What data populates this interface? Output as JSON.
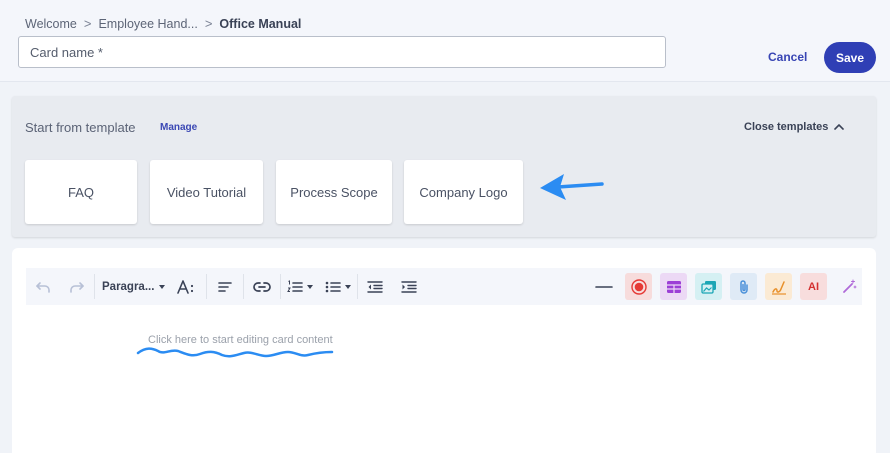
{
  "breadcrumb": {
    "items": [
      "Welcome",
      "Employee Hand..."
    ],
    "current": "Office Manual",
    "separator": ">"
  },
  "card_name": {
    "placeholder": "Card name *",
    "value": ""
  },
  "actions": {
    "cancel_label": "Cancel",
    "save_label": "Save"
  },
  "templates": {
    "label": "Start from template",
    "manage_label": "Manage",
    "close_label": "Close templates",
    "items": [
      "FAQ",
      "Video Tutorial",
      "Process Scope",
      "Company Logo"
    ]
  },
  "toolbar": {
    "paragraph_label": "Paragra...",
    "ai_label": "AI",
    "icons": [
      "undo-icon",
      "redo-icon",
      "text-style-icon",
      "align-icon",
      "link-icon",
      "ordered-list-icon",
      "bullet-list-icon",
      "outdent-icon",
      "indent-icon",
      "horizontal-rule-icon",
      "record-icon",
      "table-icon",
      "image-icon",
      "attachment-icon",
      "signature-icon",
      "ai-icon",
      "magic-wand-icon"
    ]
  },
  "editor": {
    "placeholder": "Click here to start editing card content"
  },
  "colors": {
    "accent": "#2f3fb5",
    "annotation": "#2b8cf2",
    "record": "#e53935",
    "table": "#9c3fd6",
    "image": "#1ba6b5",
    "attachment": "#4a90d9",
    "signature": "#e8902a",
    "ai": "#d32f2f",
    "magic": "#b06ad8"
  }
}
